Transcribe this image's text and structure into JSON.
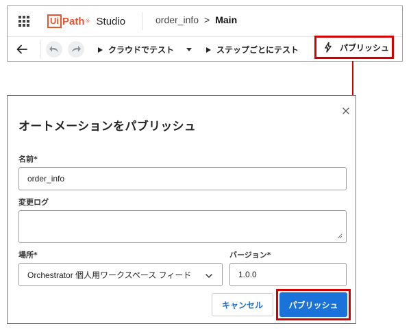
{
  "studio": {
    "logo_ui": "Ui",
    "logo_path": "Path",
    "logo_tm": "®",
    "logo_studio": "Studio",
    "breadcrumb": [
      "order_info",
      "Main"
    ],
    "breadcrumb_separator": ">",
    "toolbar": {
      "test_cloud_label": "クラウドでテスト",
      "step_test_label": "ステップごとにテスト",
      "publish_label": "パブリッシュ"
    }
  },
  "dialog": {
    "title": "オートメーションをパブリッシュ",
    "name_label": "名前*",
    "name_value": "order_info",
    "changelog_label": "変更ログ",
    "changelog_value": "",
    "location_label": "場所*",
    "location_value": "Orchestrator 個人用ワークスペース フィード",
    "version_label": "バージョン*",
    "version_value": "1.0.0",
    "cancel_label": "キャンセル",
    "publish_label": "パブリッシュ"
  },
  "colors": {
    "accent_red": "#d40000",
    "brand_orange": "#e8532b",
    "primary_blue": "#1a73d9",
    "link_blue": "#1a6fd0"
  }
}
